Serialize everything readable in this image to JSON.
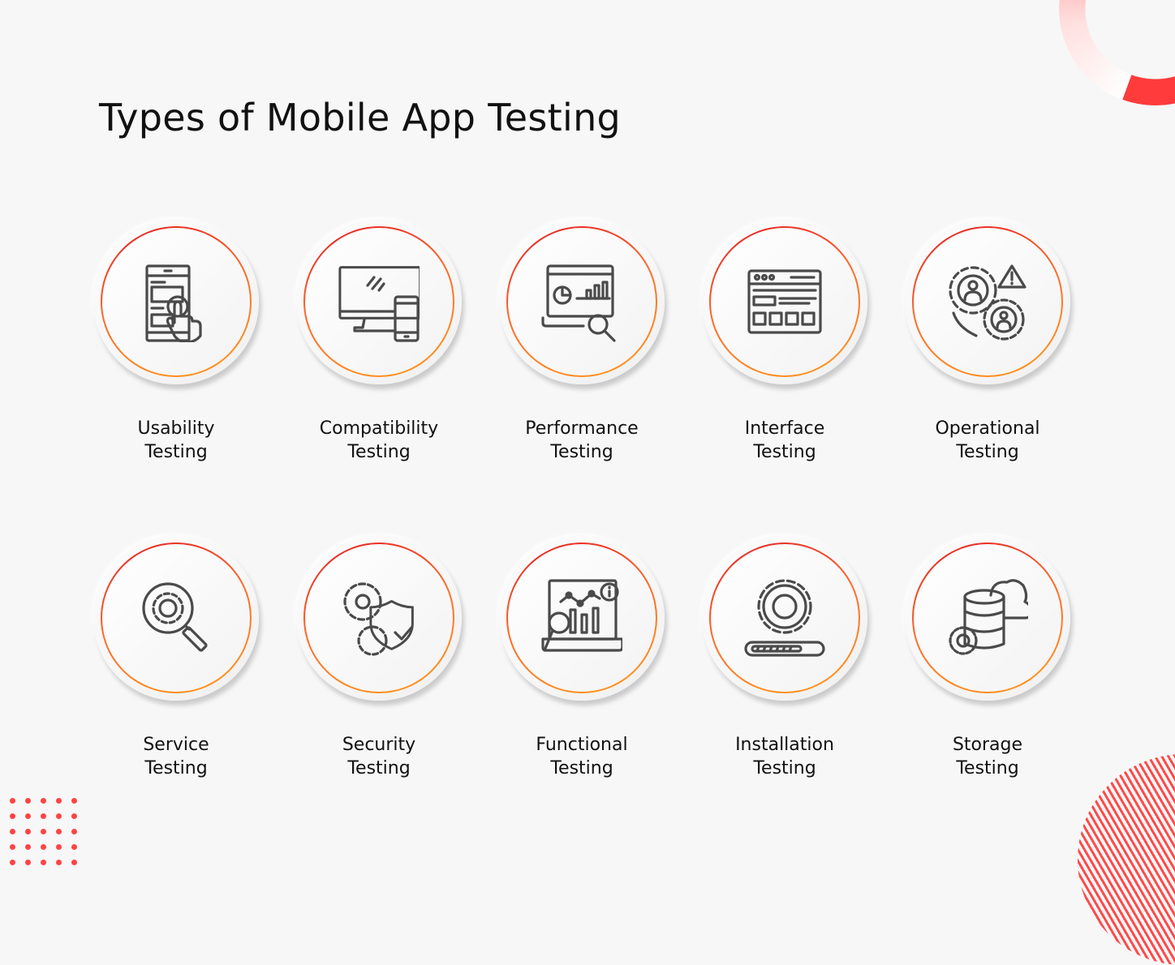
{
  "title": "Types of Mobile App Testing",
  "colors": {
    "accent": "#ff4444",
    "ring_start": "#e01b24",
    "ring_end": "#ff9a1a",
    "icon_stroke": "#4a4a4a",
    "background": "#f7f7f7"
  },
  "items": [
    {
      "line1": "Usability",
      "line2": "Testing",
      "icon": "touch-phone-icon"
    },
    {
      "line1": "Compatibility",
      "line2": "Testing",
      "icon": "monitor-phone-icon"
    },
    {
      "line1": "Performance",
      "line2": "Testing",
      "icon": "analytics-laptop-icon"
    },
    {
      "line1": "Interface",
      "line2": "Testing",
      "icon": "browser-window-icon"
    },
    {
      "line1": "Operational",
      "line2": "Testing",
      "icon": "user-gears-warning-icon"
    },
    {
      "line1": "Service",
      "line2": "Testing",
      "icon": "gear-magnifier-icon"
    },
    {
      "line1": "Security",
      "line2": "Testing",
      "icon": "gears-shield-icon"
    },
    {
      "line1": "Functional",
      "line2": "Testing",
      "icon": "chart-magnifier-icon"
    },
    {
      "line1": "Installation",
      "line2": "Testing",
      "icon": "gear-progress-icon"
    },
    {
      "line1": "Storage",
      "line2": "Testing",
      "icon": "database-cloud-icon"
    }
  ]
}
